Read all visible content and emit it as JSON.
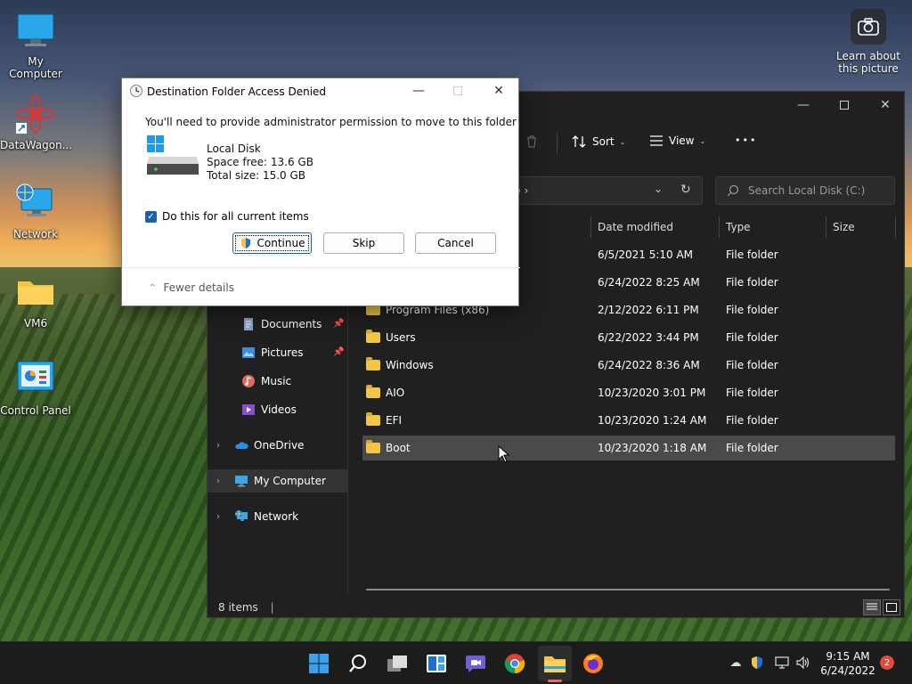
{
  "desktop": {
    "icons": [
      {
        "label": "My Computer"
      },
      {
        "label": "DataWagon..."
      },
      {
        "label": "Network"
      },
      {
        "label": "VM6"
      },
      {
        "label": "Control Panel"
      }
    ],
    "camera_label_line1": "Learn about",
    "camera_label_line2": "this picture"
  },
  "explorer": {
    "toolbar": {
      "sort_label": "Sort",
      "view_label": "View",
      "more_label": "•••"
    },
    "address_tail": ")  ›",
    "search_placeholder": "Search Local Disk (C:)",
    "sidebar": [
      {
        "label": "Documents",
        "pinned": true
      },
      {
        "label": "Pictures",
        "pinned": true
      },
      {
        "label": "Music"
      },
      {
        "label": "Videos"
      },
      {
        "label": "OneDrive"
      },
      {
        "label": "My Computer"
      },
      {
        "label": "Network"
      }
    ],
    "columns": {
      "date": "Date modified",
      "type": "Type",
      "size": "Size"
    },
    "files": [
      {
        "name": "",
        "date": "6/5/2021 5:10 AM",
        "type": "File folder"
      },
      {
        "name": "",
        "date": "6/24/2022 8:25 AM",
        "type": "File folder"
      },
      {
        "name": "Program Files (x86)",
        "date": "2/12/2022 6:11 PM",
        "type": "File folder"
      },
      {
        "name": "Users",
        "date": "6/22/2022 3:44 PM",
        "type": "File folder"
      },
      {
        "name": "Windows",
        "date": "6/24/2022 8:36 AM",
        "type": "File folder"
      },
      {
        "name": "AIO",
        "date": "10/23/2020 3:01 PM",
        "type": "File folder"
      },
      {
        "name": "EFI",
        "date": "10/23/2020 1:24 AM",
        "type": "File folder"
      },
      {
        "name": "Boot",
        "date": "10/23/2020 1:18 AM",
        "type": "File folder"
      }
    ],
    "status": "8 items"
  },
  "dialog": {
    "title": "Destination Folder Access Denied",
    "message": "You'll need to provide administrator permission to move to this folder",
    "disk_name": "Local Disk",
    "space_free": "Space free: 13.6 GB",
    "total_size": "Total size: 15.0 GB",
    "checkbox_label": "Do this for all current items",
    "continue_label": "Continue",
    "skip_label": "Skip",
    "cancel_label": "Cancel",
    "fewer_details": "Fewer details"
  },
  "taskbar": {
    "time": "9:15 AM",
    "date": "6/24/2022",
    "notifications": "2"
  }
}
